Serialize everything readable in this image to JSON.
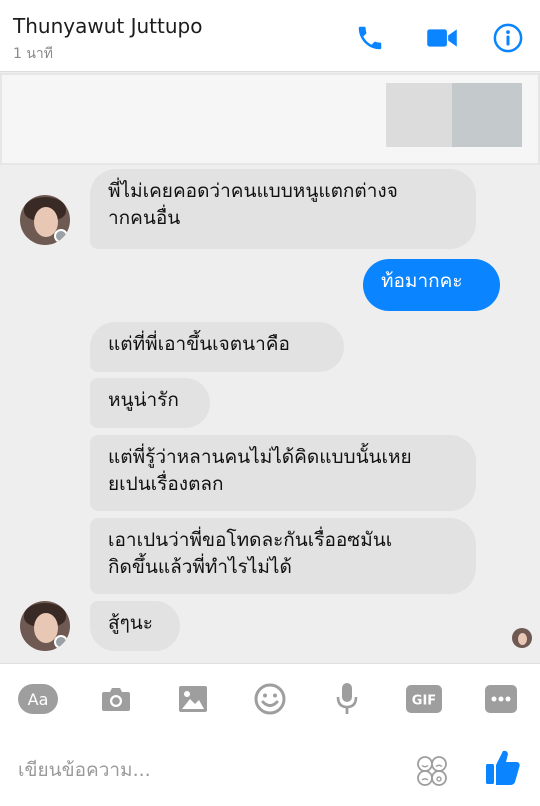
{
  "header": {
    "contact_name": "Thunyawut Juttupo",
    "last_seen": "1 นาที",
    "icons": [
      "phone-icon",
      "video-call-icon",
      "info-icon"
    ]
  },
  "colors": {
    "accent": "#0a84ff",
    "incoming_bubble": "#e2e2e2",
    "icon_gray": "#9e9e9e"
  },
  "thread": {
    "messages": [
      {
        "from": "them",
        "text_lines": [
          "พี่ไม่เคยคอดว่าคนแบบหนูแตกต่างจ",
          "ากคนอื่น"
        ]
      },
      {
        "from": "me",
        "text_lines": [
          "ท้อมากคะ"
        ]
      },
      {
        "from": "them",
        "text_lines": [
          "แต่ที่พี่เอาขึ้นเจตนาคือ"
        ]
      },
      {
        "from": "them",
        "text_lines": [
          "หนูน่ารัก"
        ]
      },
      {
        "from": "them",
        "text_lines": [
          "แต่พี่รู้ว่าหลานคนไม่ได้คิดแบบนั้นเหย",
          "ยเปนเรื่องตลก"
        ]
      },
      {
        "from": "them",
        "text_lines": [
          "เอาเปนว่าพี่ขอโทดละกันเรื่ออซมันเ",
          "กิดขึ้นแล้วพี่ทำไรไม่ได้"
        ]
      },
      {
        "from": "them",
        "text_lines": [
          "สู้ๆนะ"
        ]
      }
    ]
  },
  "toolbar": {
    "aa_label": "Aa",
    "gif_label": "GIF",
    "icons": [
      "text-style-icon",
      "camera-icon",
      "image-icon",
      "emoji-icon",
      "microphone-icon",
      "gif-icon",
      "more-icon"
    ]
  },
  "composer": {
    "placeholder": "เขียนข้อความ...",
    "icons": [
      "emoji-picker-icon",
      "like-icon"
    ]
  }
}
